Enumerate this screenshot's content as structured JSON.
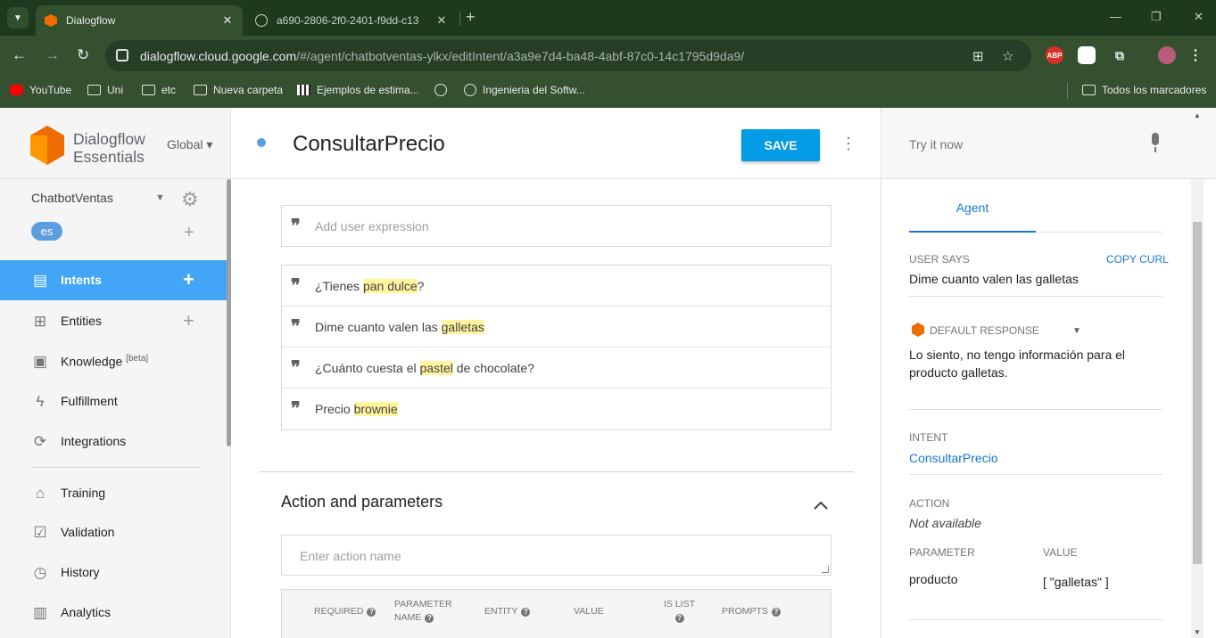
{
  "browser": {
    "tabs": [
      {
        "title": "Dialogflow",
        "active": true
      },
      {
        "title": "a690-2806-2f0-2401-f9dd-c13",
        "active": false
      }
    ],
    "url_host": "dialogflow.cloud.google.com",
    "url_path": "/#/agent/chatbotventas-ylkx/editIntent/a3a9e7d4-ba48-4abf-87c0-14c1795d9da9/",
    "bookmarks": [
      "YouTube",
      "Uni",
      "etc",
      "Nueva carpeta",
      "Ejemplos de estima...",
      "Ingenieria del Softw..."
    ],
    "all_bookmarks": "Todos los marcadores",
    "extension_abp": "ABP"
  },
  "sidebar": {
    "logo_line1": "Dialogflow",
    "logo_line2": "Essentials",
    "region": "Global",
    "agent_name": "ChatbotVentas",
    "language": "es",
    "items": [
      {
        "label": "Intents",
        "icon": "chat-bubble-icon",
        "active": true
      },
      {
        "label": "Entities",
        "icon": "hierarchy-icon"
      },
      {
        "label": "Knowledge",
        "badge": "[beta]",
        "icon": "book-icon"
      },
      {
        "label": "Fulfillment",
        "icon": "bolt-icon"
      },
      {
        "label": "Integrations",
        "icon": "sync-icon"
      },
      {
        "label": "Training",
        "icon": "graduation-cap-icon"
      },
      {
        "label": "Validation",
        "icon": "checkbox-icon"
      },
      {
        "label": "History",
        "icon": "clock-icon"
      },
      {
        "label": "Analytics",
        "icon": "bar-chart-icon"
      }
    ]
  },
  "intent": {
    "title": "ConsultarPrecio",
    "save_label": "SAVE",
    "add_expression_placeholder": "Add user expression",
    "expressions": [
      {
        "pre": "¿Tienes ",
        "hl": "pan dulce",
        "post": "?"
      },
      {
        "pre": "Dime cuanto valen las ",
        "hl": "galletas",
        "post": ""
      },
      {
        "pre": "¿Cuánto cuesta el ",
        "hl": "pastel",
        "post": " de chocolate?"
      },
      {
        "pre": "Precio ",
        "hl": "brownie",
        "post": ""
      }
    ],
    "action_section_title": "Action and parameters",
    "action_placeholder": "Enter action name",
    "param_headers": {
      "required": "REQUIRED",
      "param_name_1": "PARAMETER",
      "param_name_2": "NAME",
      "entity": "ENTITY",
      "value": "VALUE",
      "is_list_1": "IS LIST",
      "prompts": "PROMPTS"
    }
  },
  "test_console": {
    "try_placeholder": "Try it now",
    "tab_label": "Agent",
    "user_says_label": "USER SAYS",
    "copy_curl": "COPY CURL",
    "user_says_value": "Dime cuanto valen las galletas",
    "default_response_label": "DEFAULT RESPONSE",
    "default_response_line1": "Lo siento, no tengo información para el",
    "default_response_line2": "producto galletas.",
    "intent_label": "INTENT",
    "intent_value": "ConsultarPrecio",
    "action_label": "ACTION",
    "action_value": "Not available",
    "parameter_label": "PARAMETER",
    "value_label": "VALUE",
    "parameter_name": "producto",
    "parameter_value": "[ \"galletas\" ]"
  },
  "colors": {
    "accent_blue": "#42a5f5",
    "save_blue": "#039be5",
    "highlight_yellow": "#fff59d",
    "brand_orange": "#ef6c00",
    "chrome_green": "#35502f"
  }
}
